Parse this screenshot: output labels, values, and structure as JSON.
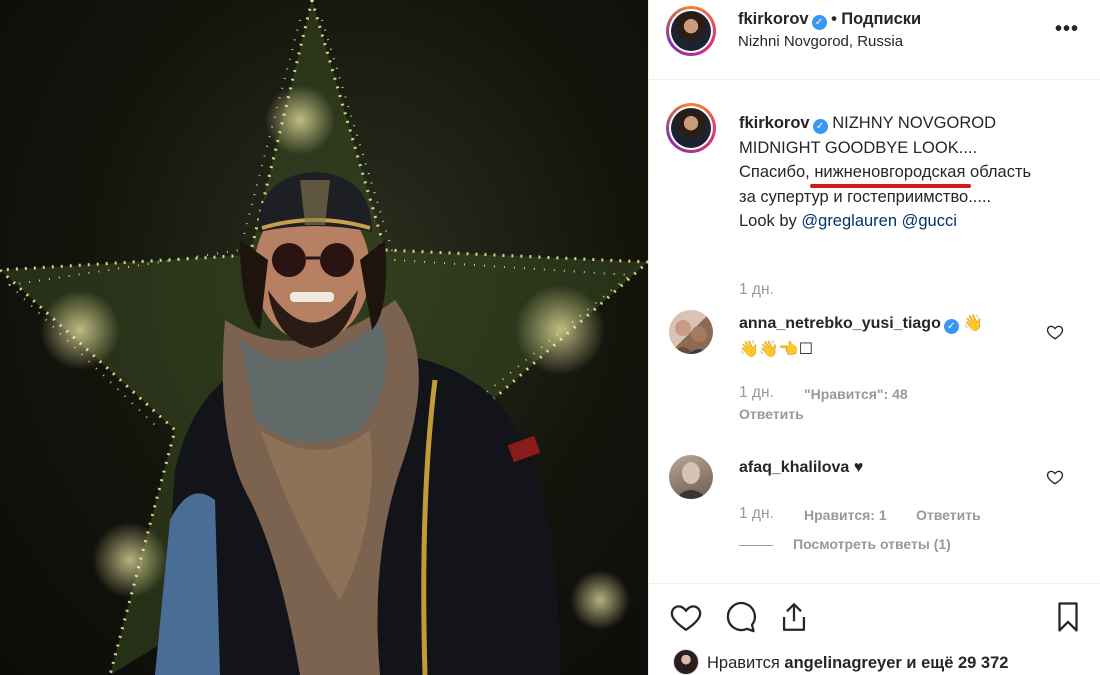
{
  "header": {
    "username": "fkirkorov",
    "separator": "•",
    "follow_label": "Подписки",
    "location": "Nizhni Novgorod, Russia",
    "more_label": "•••"
  },
  "caption": {
    "username": "fkirkorov",
    "text_1": "NIZHNY NOVGOROD MIDNIGHT GOODBYE LOOK....",
    "text_2_pre": "Спасибо,",
    "text_2_highlight": "нижненовгородская",
    "text_3": "область за супертур и гостеприимство.....",
    "look_by": "Look by",
    "tag_1": "@greglauren",
    "tag_2": "@gucci",
    "time": "1 дн."
  },
  "comments": [
    {
      "username": "anna_netrebko_yusi_tiago",
      "emoji_line_1": "👋",
      "emoji_line_2": "👋👋👈☐",
      "time": "1 дн.",
      "likes": "\"Нравится\": 48",
      "reply": "Ответить"
    },
    {
      "username": "afaq_khalilova",
      "text": "♥",
      "time": "1 дн.",
      "likes": "Нравится: 1",
      "reply": "Ответить",
      "view_replies": "Посмотреть ответы (1)"
    }
  ],
  "footer": {
    "liked_by_prefix": "Нравится",
    "liked_by_user": "angelinagreyer",
    "liked_by_suffix": "и ещё 29 372"
  },
  "colors": {
    "verified": "#3897f0",
    "link": "#003569",
    "highlight_underline": "#d31a1a",
    "muted": "#999999"
  }
}
